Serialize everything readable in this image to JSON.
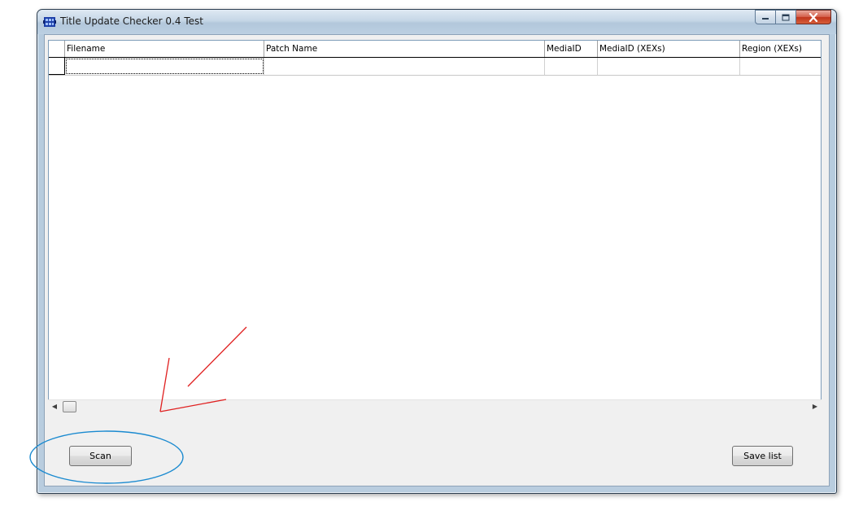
{
  "window": {
    "title": "Title Update Checker 0.4 Test",
    "caption_buttons": {
      "minimize_icon": "minimize-icon",
      "maximize_icon": "maximize-icon",
      "close_icon": "close-icon"
    }
  },
  "grid": {
    "columns": [
      "Filename",
      "Patch Name",
      "MediaID",
      "MediaID (XEXs)",
      "Region (XEXs)"
    ],
    "rows": [
      [
        "",
        "",
        "",
        "",
        ""
      ]
    ]
  },
  "scrollbar": {
    "left_arrow": "◀",
    "right_arrow": "▶"
  },
  "buttons": {
    "scan_label": "Scan",
    "save_label": "Save list"
  },
  "annotations": {
    "arrow_color": "#e02020",
    "ellipse_color": "#1a8ad0"
  }
}
